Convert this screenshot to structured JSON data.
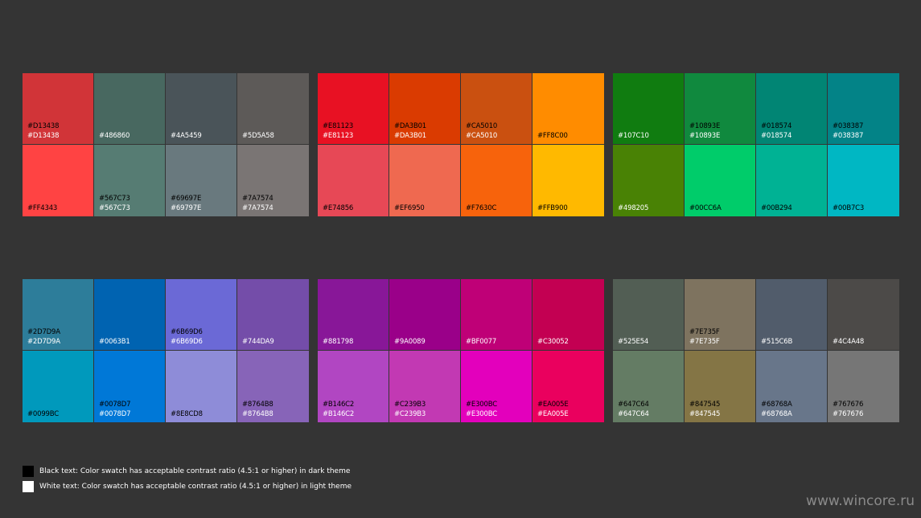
{
  "groups": [
    {
      "name": "reds-grays",
      "swatches": [
        {
          "color": "#D13438",
          "black": "#D13438",
          "white": "#D13438"
        },
        {
          "color": "#486860",
          "black": "",
          "white": "#486860"
        },
        {
          "color": "#4A5459",
          "black": "",
          "white": "#4A5459"
        },
        {
          "color": "#5D5A58",
          "black": "",
          "white": "#5D5A58"
        },
        {
          "color": "#FF4343",
          "black": "#FF4343",
          "white": ""
        },
        {
          "color": "#567C73",
          "black": "#567C73",
          "white": "#567C73"
        },
        {
          "color": "#69797E",
          "black": "#69697E",
          "white": "#69797E"
        },
        {
          "color": "#7A7574",
          "black": "#7A7574",
          "white": "#7A7574"
        }
      ]
    },
    {
      "name": "reds-oranges",
      "swatches": [
        {
          "color": "#E81123",
          "black": "#E81123",
          "white": "#E81123"
        },
        {
          "color": "#DA3B01",
          "black": "#DA3B01",
          "white": "#DA3B01"
        },
        {
          "color": "#CA5010",
          "black": "#CA5010",
          "white": "#CA5010"
        },
        {
          "color": "#FF8C00",
          "black": "#FF8C00",
          "white": ""
        },
        {
          "color": "#E74856",
          "black": "#E74856",
          "white": ""
        },
        {
          "color": "#EF6950",
          "black": "#EF6950",
          "white": ""
        },
        {
          "color": "#F7630C",
          "black": "#F7630C",
          "white": ""
        },
        {
          "color": "#FFB900",
          "black": "#FFB900",
          "white": ""
        }
      ]
    },
    {
      "name": "greens-teals",
      "swatches": [
        {
          "color": "#107C10",
          "black": "",
          "white": "#107C10"
        },
        {
          "color": "#10893E",
          "black": "#10893E",
          "white": "#10893E"
        },
        {
          "color": "#018574",
          "black": "#018574",
          "white": "#018574"
        },
        {
          "color": "#038387",
          "black": "#038387",
          "white": "#038387"
        },
        {
          "color": "#498205",
          "black": "",
          "white": "#498205"
        },
        {
          "color": "#00CC6A",
          "black": "#00CC6A",
          "white": ""
        },
        {
          "color": "#00B294",
          "black": "#00B294",
          "white": ""
        },
        {
          "color": "#00B7C3",
          "black": "#00B7C3",
          "white": ""
        }
      ]
    },
    {
      "name": "blues-purples",
      "swatches": [
        {
          "color": "#2D7D9A",
          "black": "#2D7D9A",
          "white": "#2D7D9A"
        },
        {
          "color": "#0063B1",
          "black": "",
          "white": "#0063B1"
        },
        {
          "color": "#6B69D6",
          "black": "#6B69D6",
          "white": "#6B69D6"
        },
        {
          "color": "#744DA9",
          "black": "",
          "white": "#744DA9"
        },
        {
          "color": "#0099BC",
          "black": "#0099BC",
          "white": ""
        },
        {
          "color": "#0078D7",
          "black": "#0078D7",
          "white": "#0078D7"
        },
        {
          "color": "#8E8CD8",
          "black": "#8E8CD8",
          "white": ""
        },
        {
          "color": "#8764B8",
          "black": "#8764B8",
          "white": "#8764B8"
        }
      ]
    },
    {
      "name": "magentas",
      "swatches": [
        {
          "color": "#881798",
          "black": "",
          "white": "#881798"
        },
        {
          "color": "#9A0089",
          "black": "",
          "white": "#9A0089"
        },
        {
          "color": "#BF0077",
          "black": "",
          "white": "#BF0077"
        },
        {
          "color": "#C30052",
          "black": "",
          "white": "#C30052"
        },
        {
          "color": "#B146C2",
          "black": "#B146C2",
          "white": "#B146C2"
        },
        {
          "color": "#C239B3",
          "black": "#C239B3",
          "white": "#C239B3"
        },
        {
          "color": "#E300BC",
          "black": "#E300BC",
          "white": "#E300BC"
        },
        {
          "color": "#EA005E",
          "black": "#EA005E",
          "white": "#EA005E"
        }
      ]
    },
    {
      "name": "neutrals",
      "swatches": [
        {
          "color": "#525E54",
          "black": "",
          "white": "#525E54"
        },
        {
          "color": "#7E735F",
          "black": "#7E735F",
          "white": "#7E735F"
        },
        {
          "color": "#515C6B",
          "black": "",
          "white": "#515C6B"
        },
        {
          "color": "#4C4A48",
          "black": "",
          "white": "#4C4A48"
        },
        {
          "color": "#647C64",
          "black": "#647C64",
          "white": "#647C64"
        },
        {
          "color": "#847545",
          "black": "#847545",
          "white": "#847545"
        },
        {
          "color": "#68768A",
          "black": "#68768A",
          "white": "#68768A"
        },
        {
          "color": "#767676",
          "black": "#767676",
          "white": "#767676"
        }
      ]
    }
  ],
  "legend": {
    "black_text": "Black text: Color swatch has acceptable contrast ratio (4.5:1 or higher) in dark theme",
    "white_text": "White text: Color swatch has acceptable contrast ratio (4.5:1 or higher) in light theme",
    "black_box_color": "#000000",
    "white_box_color": "#FFFFFF"
  },
  "watermark": "www.wincore.ru"
}
